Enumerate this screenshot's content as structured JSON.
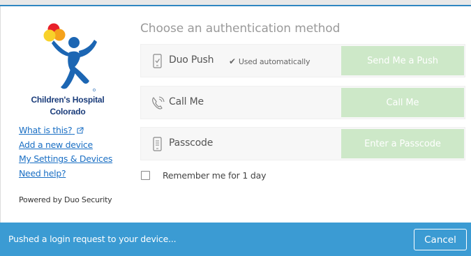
{
  "logo": {
    "line1": "Children's Hospital",
    "line2": "Colorado",
    "colors": {
      "red": "#e8202a",
      "orange": "#f5a21b",
      "yellow": "#f8d22a",
      "blue": "#1c66b3",
      "navy": "#1a3c7a"
    }
  },
  "sidebar": {
    "links": [
      {
        "label": "What is this?",
        "icon": "external-link-icon"
      },
      {
        "label": "Add a new device"
      },
      {
        "label": "My Settings & Devices"
      },
      {
        "label": "Need help?"
      }
    ],
    "powered_by": "Powered by Duo Security"
  },
  "main": {
    "heading": "Choose an authentication method",
    "methods": [
      {
        "icon": "phone-check-icon",
        "label": "Duo Push",
        "note": "Used automatically",
        "note_icon": "checkmark-icon",
        "button": "Send Me a Push"
      },
      {
        "icon": "phone-call-icon",
        "label": "Call Me",
        "button": "Call Me"
      },
      {
        "icon": "passcode-icon",
        "label": "Passcode",
        "button": "Enter a Passcode"
      }
    ],
    "remember_label": "Remember me for 1 day"
  },
  "status": {
    "message": "Pushed a login request to your device...",
    "cancel_label": "Cancel"
  },
  "colors": {
    "status_bar": "#3b9bd3",
    "action_button": "#cde8c8",
    "link": "#1a6fc4",
    "heading": "#9a9a9a"
  }
}
